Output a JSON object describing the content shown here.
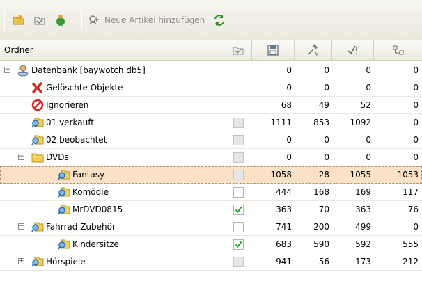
{
  "toolbar": {
    "add_label": "Neue Artikel hinzufügen"
  },
  "columns": {
    "folder": "Ordner"
  },
  "rows": [
    {
      "label": "Datenbank [baywotch.db5]",
      "check": "none",
      "c1": "0",
      "c2": "0",
      "c3": "0",
      "c4": "0"
    },
    {
      "label": "Gelöschte Objekte",
      "check": "none",
      "c1": "0",
      "c2": "0",
      "c3": "0",
      "c4": "0"
    },
    {
      "label": "Ignorieren",
      "check": "none",
      "c1": "68",
      "c2": "49",
      "c3": "52",
      "c4": "0"
    },
    {
      "label": "01 verkauft",
      "check": "grey",
      "c1": "1111",
      "c2": "853",
      "c3": "1092",
      "c4": "0"
    },
    {
      "label": "02 beobachtet",
      "check": "grey",
      "c1": "0",
      "c2": "0",
      "c3": "0",
      "c4": "0"
    },
    {
      "label": "DVDs",
      "check": "grey",
      "c1": "0",
      "c2": "0",
      "c3": "0",
      "c4": "0"
    },
    {
      "label": "Fantasy",
      "check": "grey",
      "c1": "1058",
      "c2": "28",
      "c3": "1055",
      "c4": "1053"
    },
    {
      "label": "Komödie",
      "check": "empty",
      "c1": "444",
      "c2": "168",
      "c3": "169",
      "c4": "117"
    },
    {
      "label": "MrDVD0815",
      "check": "checked",
      "c1": "363",
      "c2": "70",
      "c3": "363",
      "c4": "76"
    },
    {
      "label": "Fahrrad Zubehör",
      "check": "empty",
      "c1": "741",
      "c2": "200",
      "c3": "499",
      "c4": "0"
    },
    {
      "label": "Kindersitze",
      "check": "checked",
      "c1": "683",
      "c2": "590",
      "c3": "592",
      "c4": "555"
    },
    {
      "label": "Hörspiele",
      "check": "grey",
      "c1": "941",
      "c2": "56",
      "c3": "173",
      "c4": "212"
    }
  ],
  "selected_row": "Fantasy",
  "colors": {
    "selection": "#fbe2c6",
    "check_green": "#21a121",
    "folder_yellow": "#f3cf5a",
    "delete_red": "#d9261c"
  }
}
